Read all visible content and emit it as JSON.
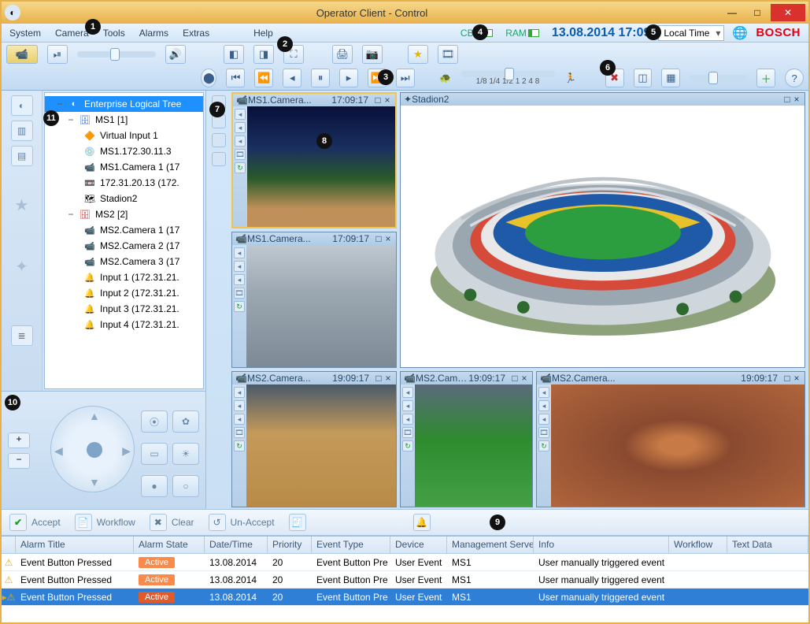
{
  "window": {
    "title": "Operator Client - Control"
  },
  "menu": {
    "system": "System",
    "camera": "Camera",
    "tools": "Tools",
    "alarms": "Alarms",
    "extras": "Extras",
    "help": "Help"
  },
  "header": {
    "cbr": "CBR",
    "ram": "RAM",
    "datetime": "13.08.2014 17:09",
    "timezone": "Local Time",
    "brand": "BOSCH"
  },
  "playback": {
    "speeds": "1/8 1/4 1/2 1  2  4  8"
  },
  "tree": {
    "root": "Enterprise Logical Tree",
    "ms1": "MS1 [1]",
    "ms1_items": [
      "Virtual Input 1",
      "MS1.172.30.11.3",
      "MS1.Camera 1 (17",
      "172.31.20.13 (172.",
      "Stadion2"
    ],
    "ms2": "MS2 [2]",
    "ms2_items": [
      "MS2.Camera 1 (17",
      "MS2.Camera 2 (17",
      "MS2.Camera 3 (17",
      "Input 1 (172.31.21.",
      "Input 2 (172.31.21.",
      "Input 3 (172.31.21.",
      "Input 4 (172.31.21."
    ]
  },
  "panes": {
    "a": {
      "name": "MS1.Camera...",
      "time": "17:09:17"
    },
    "b": {
      "name": "MS1.Camera...",
      "time": "17:09:17"
    },
    "map": {
      "name": "Stadion2"
    },
    "d": {
      "name": "MS2.Camera...",
      "time": "19:09:17"
    },
    "e": {
      "name": "MS2.Camera...",
      "time": "19:09:17"
    },
    "f": {
      "name": "MS2.Camera...",
      "time": "19:09:17"
    }
  },
  "alarmbar": {
    "accept": "Accept",
    "workflow": "Workflow",
    "clear": "Clear",
    "unaccept": "Un-Accept"
  },
  "table": {
    "headers": {
      "title": "Alarm Title",
      "state": "Alarm State",
      "datetime": "Date/Time",
      "priority": "Priority",
      "eventtype": "Event Type",
      "device": "Device",
      "mgmt": "Management Serve",
      "info": "Info",
      "workflow": "Workflow",
      "text": "Text Data"
    },
    "rows": [
      {
        "title": "Event Button Pressed",
        "state": "Active",
        "date": "13.08.2014",
        "prio": "20",
        "etype": "Event Button Pre",
        "dev": "User Event",
        "mgmt": "MS1",
        "info": "User manually triggered event"
      },
      {
        "title": "Event Button Pressed",
        "state": "Active",
        "date": "13.08.2014",
        "prio": "20",
        "etype": "Event Button Pre",
        "dev": "User Event",
        "mgmt": "MS1",
        "info": "User manually triggered event"
      },
      {
        "title": "Event Button Pressed",
        "state": "Active",
        "date": "13.08.2014",
        "prio": "20",
        "etype": "Event Button Pre",
        "dev": "User Event",
        "mgmt": "MS1",
        "info": "User manually triggered event"
      }
    ]
  },
  "callouts": {
    "n1": "1",
    "n2": "2",
    "n3": "3",
    "n4": "4",
    "n5": "5",
    "n6": "6",
    "n7": "7",
    "n8": "8",
    "n9": "9",
    "n10": "10",
    "n11": "11"
  }
}
